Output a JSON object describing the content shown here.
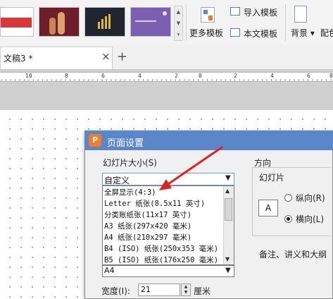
{
  "ribbon": {
    "thumb_scroll_glyphs": "▲ ▼ ▾",
    "more_templates": "更多模板",
    "import_template": "导入模板",
    "this_doc_template": "本文模板",
    "background": "背景 ▾",
    "match": "配色"
  },
  "tabs": {
    "doc_tab": "文稿3 *",
    "close": "×",
    "add": "+"
  },
  "ruler": {
    "labels": [
      "10",
      "8",
      "6",
      "4",
      "2",
      "0",
      "2",
      "4",
      "6",
      "8"
    ]
  },
  "dialog": {
    "title": "页面设置",
    "app_icon_letter": "P",
    "slide_size_label": "幻灯片大小(S)",
    "selected_size": "自定义",
    "size_options": [
      "全屏显示(4:3)",
      "Letter 纸张(8.5x11 英寸)",
      "分类账纸张(11x17 英寸)",
      "A3 纸张(297x420 毫米)",
      "A4 纸张(210x297 毫米)",
      "B4 (ISO) 纸张(250x353 毫米)",
      "B5 (ISO) 纸张(176x250 毫米)"
    ],
    "second_select_value": "A4",
    "width_label": "宽度(I):",
    "width_value": "21",
    "width_unit": "厘米",
    "orientation_label": "方向",
    "slide_orientation_label": "幻灯片",
    "orientation_icon": "A",
    "portrait": "纵向(R)",
    "landscape": "横向(L)",
    "landscape_selected": true,
    "notes_label": "备注、讲义和大纲"
  },
  "colors": {
    "dialog_title_bar": "#5b86c9",
    "annotation_arrow": "#e02020"
  }
}
